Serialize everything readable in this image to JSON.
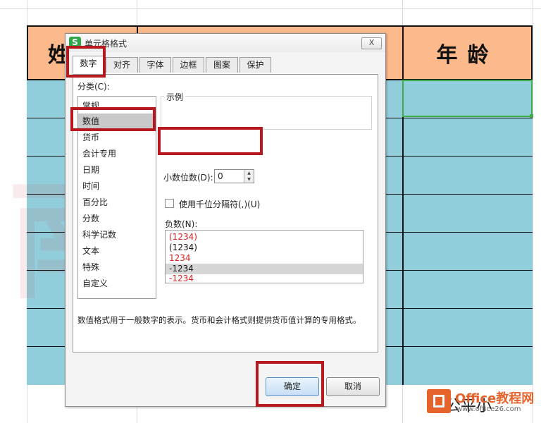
{
  "sheet": {
    "header_left": "姓",
    "header_right": "年龄",
    "watermark": "南GO",
    "behind_text": "公平小"
  },
  "dialog": {
    "title": "单元格格式",
    "close_label": "X",
    "tabs": [
      "数字",
      "对齐",
      "字体",
      "边框",
      "图案",
      "保护"
    ],
    "active_tab": "数字",
    "category_label": "分类(C):",
    "categories": [
      "常规",
      "数值",
      "货币",
      "会计专用",
      "日期",
      "时间",
      "百分比",
      "分数",
      "科学记数",
      "文本",
      "特殊",
      "自定义"
    ],
    "selected_category": "数值",
    "sample_label": "示例",
    "sample_value": "",
    "decimal_label": "小数位数(D):",
    "decimal_value": "0",
    "thousands_label": "使用千位分隔符(,)(U)",
    "thousands_checked": false,
    "negative_label": "负数(N):",
    "negative_options": [
      {
        "text": "(1234)",
        "color": "#e02020"
      },
      {
        "text": "(1234)",
        "color": "#111111"
      },
      {
        "text": "1234",
        "color": "#e02020"
      },
      {
        "text": "-1234",
        "color": "#111111"
      },
      {
        "text": "-1234",
        "color": "#e02020"
      }
    ],
    "selected_negative_index": 3,
    "description": "数值格式用于一般数字的表示。货币和会计格式则提供货币值计算的专用格式。",
    "ok_label": "确定",
    "cancel_label": "取消"
  },
  "logo": {
    "text": "Office教程网",
    "url": "www.office26.com"
  },
  "colors": {
    "header_fill": "#fbb98c",
    "data_fill": "#92cddc",
    "highlight": "#b7191f",
    "selection": "#3fae49"
  }
}
